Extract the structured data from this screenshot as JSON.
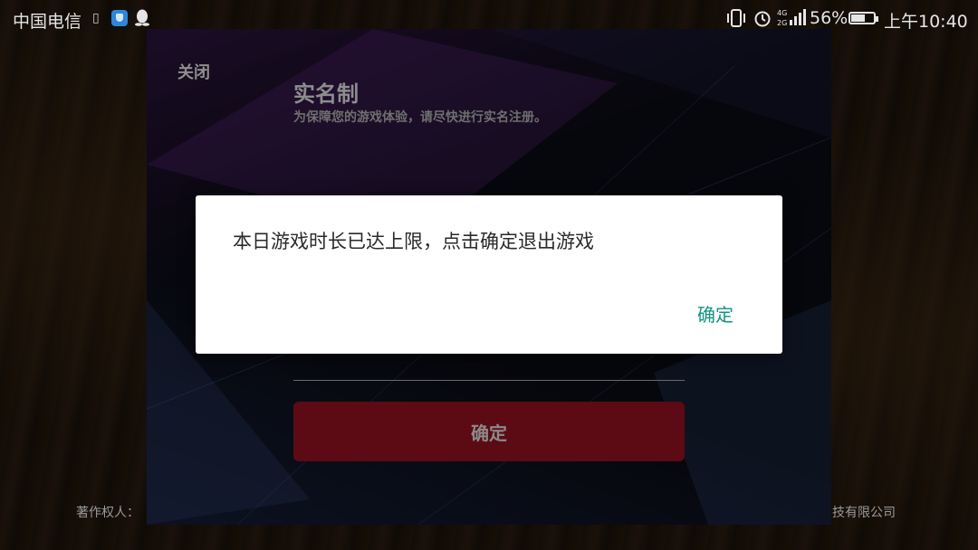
{
  "status_bar": {
    "carrier": "中国电信",
    "battery_percent": "56%",
    "time": "上午10:40",
    "icons": [
      "sim-card-icon",
      "security-shield-icon",
      "qq-icon",
      "vibrate-icon",
      "alarm-icon",
      "signal-4g-icon",
      "battery-icon"
    ]
  },
  "footer": {
    "left_text": "著作权人：",
    "right_text": "技有限公司"
  },
  "realname_panel": {
    "close_label": "关闭",
    "title": "实名制",
    "subtitle": "为保障您的游戏体验，请尽快进行实名注册。",
    "confirm_label": "确定"
  },
  "alert": {
    "message": "本日游戏时长已达上限，点击确定退出游戏",
    "confirm_label": "确定",
    "confirm_color": "#129282"
  },
  "colors": {
    "panel_button": "#5c0a14",
    "dialog_bg": "#ffffff"
  }
}
